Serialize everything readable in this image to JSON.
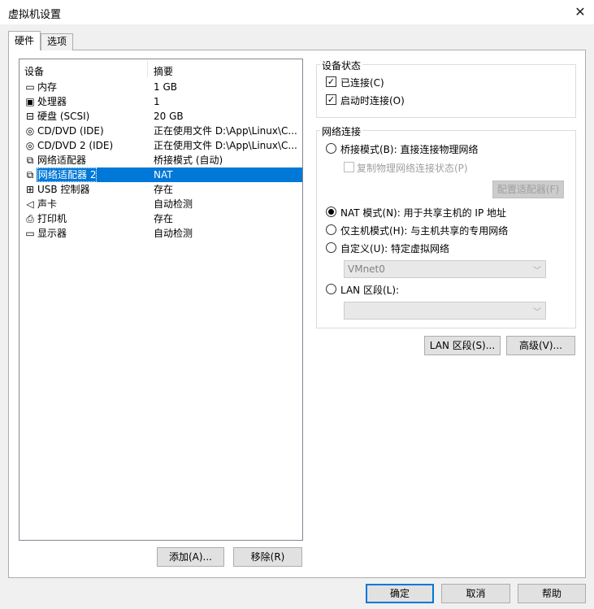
{
  "window": {
    "title": "虚拟机设置",
    "close_glyph": "✕"
  },
  "tabs": [
    {
      "label": "硬件"
    },
    {
      "label": "选项"
    }
  ],
  "device_list": {
    "headers": {
      "device": "设备",
      "summary": "摘要"
    },
    "rows": [
      {
        "icon": "memory-icon",
        "glyph": "▭",
        "device": "内存",
        "summary": "1 GB"
      },
      {
        "icon": "processor-icon",
        "glyph": "▣",
        "device": "处理器",
        "summary": "1"
      },
      {
        "icon": "hard-disk-icon",
        "glyph": "⊟",
        "device": "硬盘 (SCSI)",
        "summary": "20 GB"
      },
      {
        "icon": "cd-dvd-icon",
        "glyph": "◎",
        "device": "CD/DVD (IDE)",
        "summary": "正在使用文件 D:\\App\\Linux\\C..."
      },
      {
        "icon": "cd-dvd-icon",
        "glyph": "◎",
        "device": "CD/DVD 2 (IDE)",
        "summary": "正在使用文件 D:\\App\\Linux\\C..."
      },
      {
        "icon": "network-adapter-icon",
        "glyph": "⧉",
        "device": "网络适配器",
        "summary": "桥接模式 (自动)"
      },
      {
        "icon": "network-adapter-icon",
        "glyph": "⧉",
        "device": "网络适配器 2",
        "summary": "NAT"
      },
      {
        "icon": "usb-icon",
        "glyph": "⊞",
        "device": "USB 控制器",
        "summary": "存在"
      },
      {
        "icon": "speaker-icon",
        "glyph": "◁",
        "device": "声卡",
        "summary": "自动检测"
      },
      {
        "icon": "printer-icon",
        "glyph": "⎙",
        "device": "打印机",
        "summary": "存在"
      },
      {
        "icon": "display-icon",
        "glyph": "▭",
        "device": "显示器",
        "summary": "自动检测"
      }
    ],
    "selected_device": "网络适配器 2"
  },
  "list_buttons": {
    "add": "添加(A)...",
    "remove": "移除(R)"
  },
  "device_status": {
    "title": "设备状态",
    "connected": {
      "label": "已连接(C)",
      "checked": true
    },
    "connect_on_power": {
      "label": "启动时连接(O)",
      "checked": true
    }
  },
  "network": {
    "title": "网络连接",
    "bridged": {
      "label": "桥接模式(B): 直接连接物理网络",
      "selected": false
    },
    "replicate": {
      "label": "复制物理网络连接状态(P)",
      "checked": false
    },
    "configure_adapters": "配置适配器(F)",
    "nat": {
      "label": "NAT 模式(N): 用于共享主机的 IP 地址",
      "selected": true
    },
    "host_only": {
      "label": "仅主机模式(H): 与主机共享的专用网络",
      "selected": false
    },
    "custom": {
      "label": "自定义(U): 特定虚拟网络",
      "selected": false
    },
    "custom_value": "VMnet0",
    "lan_segment": {
      "label": "LAN 区段(L):",
      "selected": false
    },
    "lan_value": "",
    "lan_segments_button": "LAN 区段(S)...",
    "advanced_button": "高级(V)..."
  },
  "dialog_buttons": {
    "ok": "确定",
    "cancel": "取消",
    "help": "帮助"
  },
  "colors": {
    "selection": "#0078d7",
    "background": "#f0f0f0"
  }
}
